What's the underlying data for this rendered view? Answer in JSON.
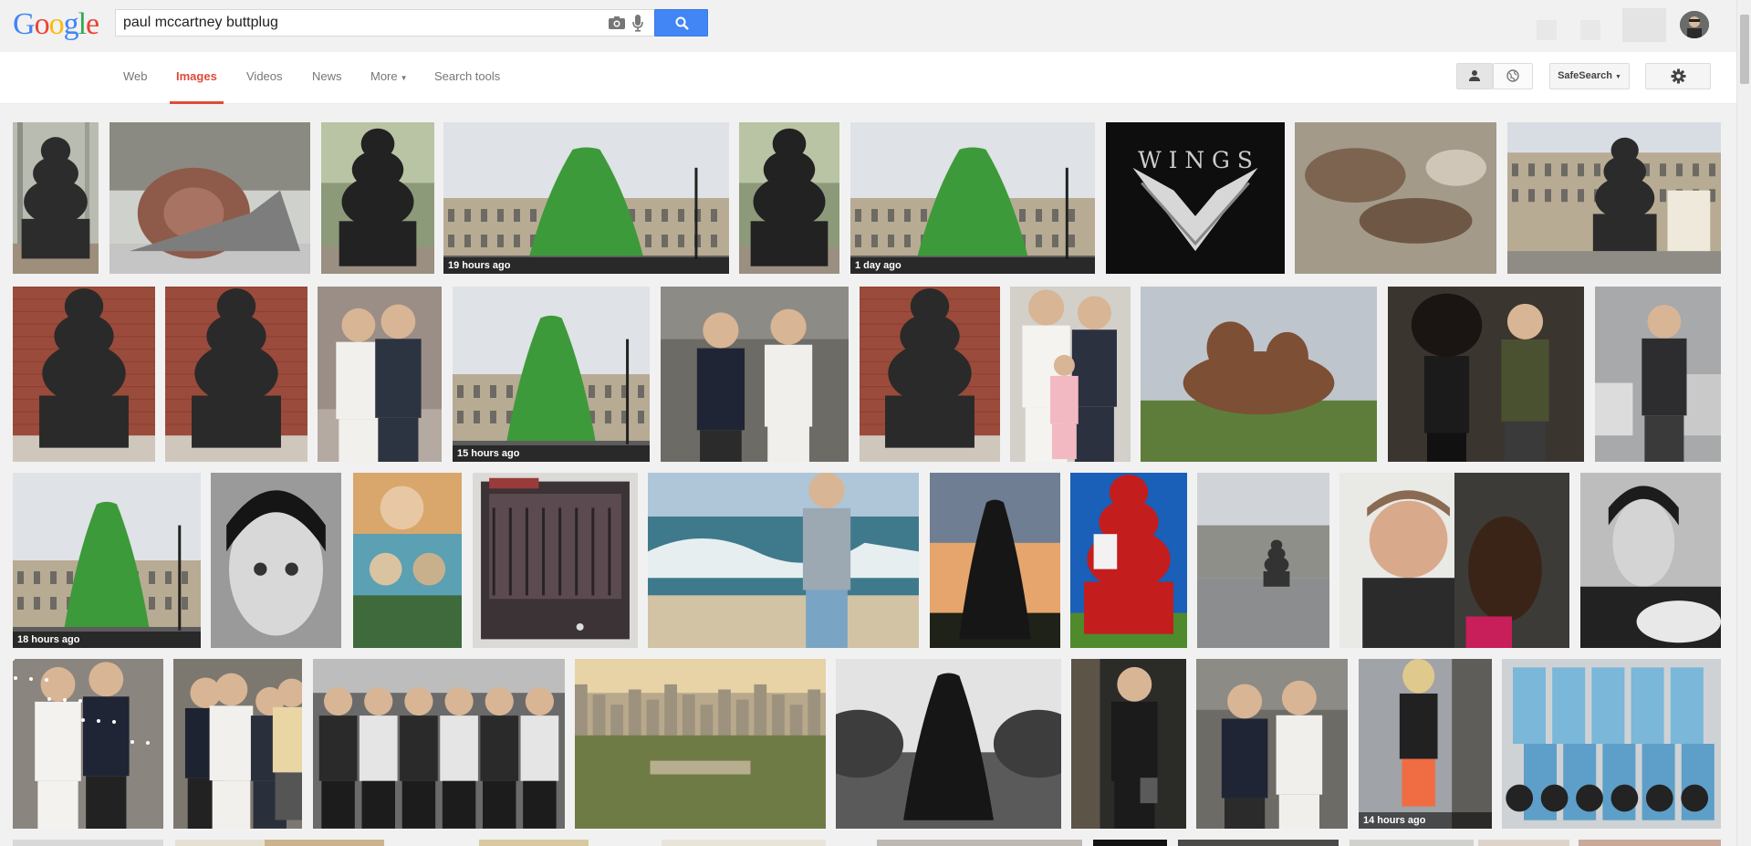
{
  "logo": {
    "letters": [
      "G",
      "o",
      "o",
      "g",
      "l",
      "e"
    ],
    "colors": [
      "#4285f4",
      "#ea4335",
      "#fbbc05",
      "#4285f4",
      "#34a853",
      "#ea4335"
    ]
  },
  "search": {
    "query": "paul mccartney buttplug"
  },
  "nav": {
    "tabs": [
      {
        "label": "Web",
        "active": false
      },
      {
        "label": "Images",
        "active": true
      },
      {
        "label": "Videos",
        "active": false
      },
      {
        "label": "News",
        "active": false
      },
      {
        "label": "More",
        "active": false
      },
      {
        "label": "Search tools",
        "active": false
      }
    ],
    "safesearch_label": "SafeSearch",
    "accent_color": "#dd4b39"
  },
  "images": {
    "row1": [
      {
        "subject": "statue-tree",
        "timestamp": ""
      },
      {
        "subject": "snail",
        "timestamp": ""
      },
      {
        "subject": "gnome",
        "timestamp": ""
      },
      {
        "subject": "green-cone",
        "timestamp": "19 hours ago"
      },
      {
        "subject": "gnome",
        "timestamp": ""
      },
      {
        "subject": "green-cone",
        "timestamp": "1 day ago"
      },
      {
        "subject": "wings-logo",
        "timestamp": ""
      },
      {
        "subject": "brown-blobs",
        "timestamp": ""
      },
      {
        "subject": "street-gnome",
        "timestamp": ""
      }
    ],
    "row2": [
      {
        "subject": "gnome-wall",
        "timestamp": ""
      },
      {
        "subject": "gnome-wall",
        "timestamp": ""
      },
      {
        "subject": "couple",
        "timestamp": ""
      },
      {
        "subject": "green-cone",
        "timestamp": "15 hours ago"
      },
      {
        "subject": "wedding",
        "timestamp": ""
      },
      {
        "subject": "gnome-wall",
        "timestamp": ""
      },
      {
        "subject": "wedding-child",
        "timestamp": ""
      },
      {
        "subject": "brown-sculpture",
        "timestamp": ""
      },
      {
        "subject": "couple-dark",
        "timestamp": ""
      },
      {
        "subject": "man-cars",
        "timestamp": ""
      }
    ],
    "row3": [
      {
        "subject": "green-cone",
        "timestamp": "18 hours ago"
      },
      {
        "subject": "face-sketch",
        "timestamp": ""
      },
      {
        "subject": "poster",
        "timestamp": ""
      },
      {
        "subject": "album",
        "timestamp": ""
      },
      {
        "subject": "beach",
        "timestamp": ""
      },
      {
        "subject": "dark-cone-sunset",
        "timestamp": ""
      },
      {
        "subject": "red-gnome",
        "timestamp": ""
      },
      {
        "subject": "distant-statue",
        "timestamp": ""
      },
      {
        "subject": "paul-woman",
        "timestamp": ""
      },
      {
        "subject": "bw-portrait",
        "timestamp": ""
      }
    ],
    "row4": [
      {
        "subject": "wedding-confetti",
        "timestamp": ""
      },
      {
        "subject": "wedding-crowd",
        "timestamp": ""
      },
      {
        "subject": "bw-group",
        "timestamp": ""
      },
      {
        "subject": "cityscape",
        "timestamp": ""
      },
      {
        "subject": "bw-cone",
        "timestamp": ""
      },
      {
        "subject": "woman-street",
        "timestamp": ""
      },
      {
        "subject": "wedding",
        "timestamp": ""
      },
      {
        "subject": "woman-tshirt",
        "timestamp": "14 hours ago"
      },
      {
        "subject": "figures-shelf",
        "timestamp": ""
      }
    ]
  }
}
